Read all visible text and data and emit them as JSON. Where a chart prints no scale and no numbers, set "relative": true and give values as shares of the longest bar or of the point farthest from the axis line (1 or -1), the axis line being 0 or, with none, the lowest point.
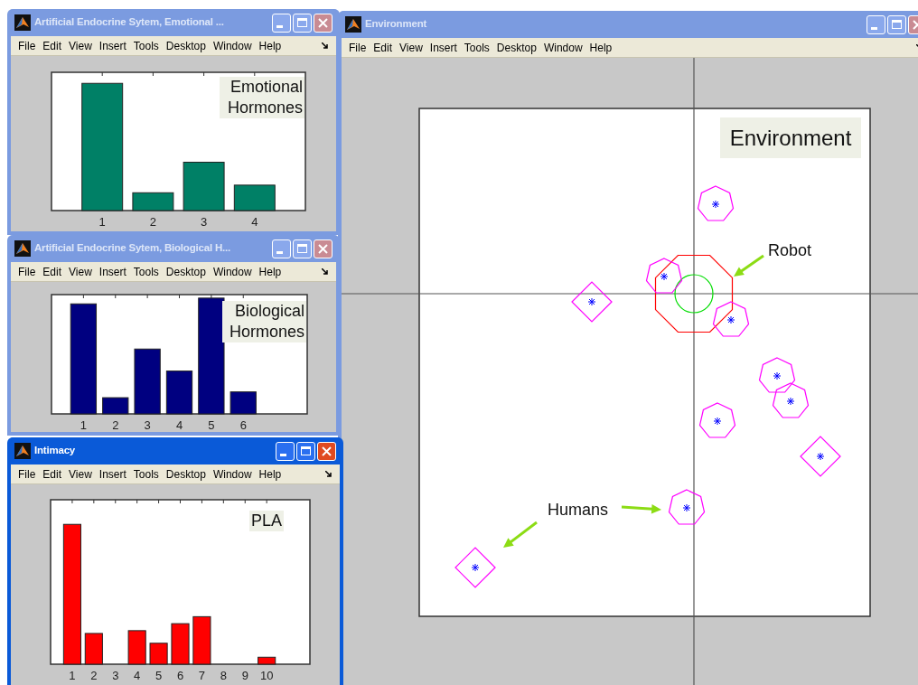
{
  "windows": [
    {
      "title": "Artificial Endocrine Sytem, Emotional ...",
      "active": false,
      "menu": [
        "File",
        "Edit",
        "View",
        "Insert",
        "Tools",
        "Desktop",
        "Window",
        "Help"
      ],
      "legend_lines": [
        "Emotional",
        "Hormones"
      ],
      "chart_data": {
        "type": "bar",
        "relative": true,
        "categories": [
          "1",
          "2",
          "3",
          "4"
        ],
        "series": [
          {
            "color": "#008066",
            "values": [
              1,
              0.14,
              0.38,
              0.2
            ]
          }
        ]
      }
    },
    {
      "title": "Artificial Endocrine Sytem, Biological H...",
      "active": false,
      "menu": [
        "File",
        "Edit",
        "View",
        "Insert",
        "Tools",
        "Desktop",
        "Window",
        "Help"
      ],
      "legend_lines": [
        "Biological",
        "Hormones"
      ],
      "chart_data": {
        "type": "bar",
        "relative": true,
        "categories": [
          "1",
          "2",
          "3",
          "4",
          "5",
          "6"
        ],
        "series": [
          {
            "color": "#000080",
            "values": [
              0.95,
              0.14,
              0.56,
              0.37,
              1,
              0.19
            ]
          }
        ]
      }
    },
    {
      "title": "Intimacy",
      "active": true,
      "menu": [
        "File",
        "Edit",
        "View",
        "Insert",
        "Tools",
        "Desktop",
        "Window",
        "Help"
      ],
      "legend_lines": [
        "PLA"
      ],
      "chart_data": {
        "type": "bar",
        "relative": true,
        "categories": [
          "1",
          "2",
          "3",
          "4",
          "5",
          "6",
          "7",
          "8",
          "9",
          "10"
        ],
        "series": [
          {
            "color": "#ff0000",
            "values": [
              1,
              0.22,
              0,
              0.24,
              0.15,
              0.29,
              0.34,
              0,
              0,
              0.05
            ]
          }
        ]
      }
    }
  ],
  "environment": {
    "title": "Environment",
    "active": false,
    "menu": [
      "File",
      "Edit",
      "View",
      "Insert",
      "Tools",
      "Desktop",
      "Window",
      "Help"
    ],
    "legend": "Environment",
    "robot_label": "Robot",
    "humans_label": "Humans"
  }
}
